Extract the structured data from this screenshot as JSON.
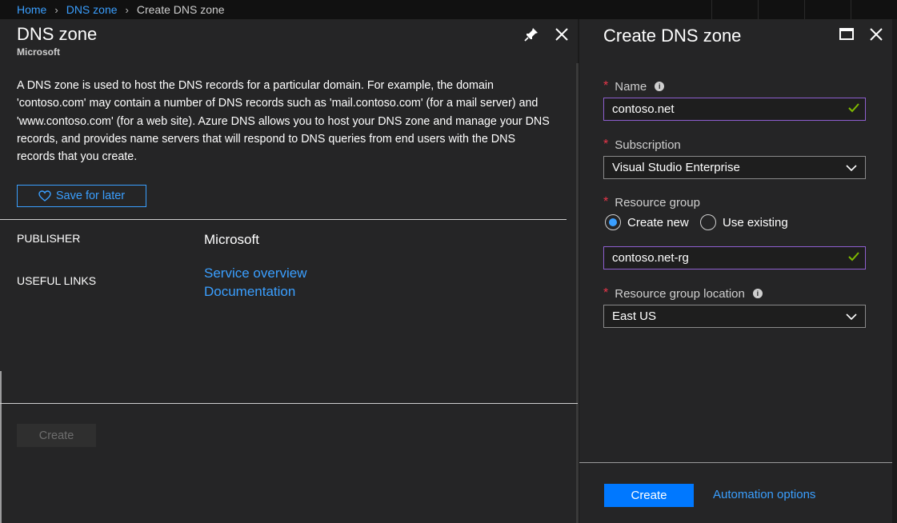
{
  "breadcrumb": {
    "home": "Home",
    "dns_zone": "DNS zone",
    "current": "Create DNS zone"
  },
  "left_blade": {
    "title": "DNS zone",
    "subtitle": "Microsoft",
    "pin_icon": "pin-icon",
    "close_icon": "close-icon",
    "description": "A DNS zone is used to host the DNS records for a particular domain. For example, the domain 'contoso.com' may contain a number of DNS records such as 'mail.contoso.com' (for a mail server) and 'www.contoso.com' (for a web site). Azure DNS allows you to host your DNS zone and manage your DNS records, and provides name servers that will respond to DNS queries from end users with the DNS records that you create.",
    "save_label": "Save for later",
    "publisher_label": "PUBLISHER",
    "publisher_value": "Microsoft",
    "links_label": "USEFUL LINKS",
    "links": [
      "Service overview",
      "Documentation"
    ],
    "create_label": "Create"
  },
  "right_blade": {
    "title": "Create DNS zone",
    "maximize_icon": "maximize-icon",
    "close_icon": "close-icon",
    "required_mark": "*",
    "name_label": "Name",
    "name_value": "contoso.net",
    "subscription_label": "Subscription",
    "subscription_value": "Visual Studio Enterprise",
    "resource_group_label": "Resource group",
    "radio_create_new": "Create new",
    "radio_use_existing": "Use existing",
    "resource_group_selected": "Create new",
    "resource_group_value": "contoso.net-rg",
    "location_label": "Resource group location",
    "location_value": "East US",
    "info_glyph": "i",
    "create_label": "Create",
    "automation_label": "Automation options"
  },
  "colors": {
    "accent": "#0078ff",
    "link": "#3a9fff",
    "valid_border": "#8e5fcf",
    "valid_check": "#7fba00",
    "required": "#e8364a"
  }
}
